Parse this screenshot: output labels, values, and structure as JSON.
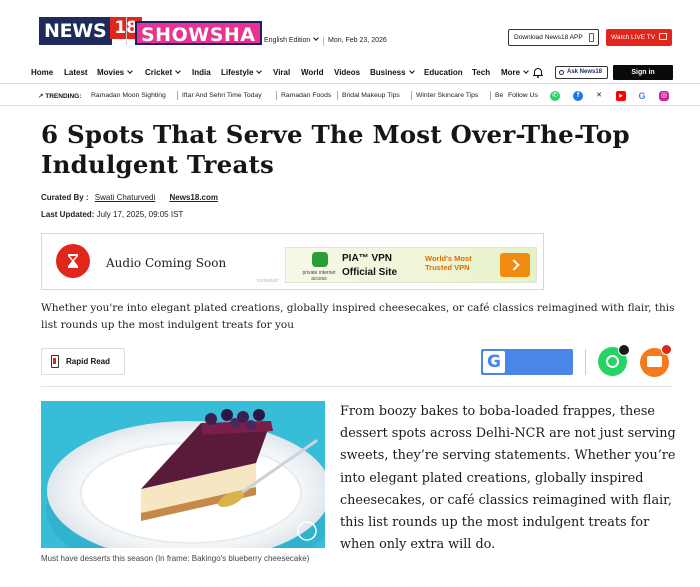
{
  "header": {
    "logo_news": "NEWS",
    "logo_num": "18",
    "logo_showsha": "SHOWSHA",
    "edition": "English Edition",
    "date": "Mon, Feb 23, 2026",
    "download_label": "Download News18 APP",
    "live_label": "Watch LIVE TV"
  },
  "nav": {
    "items": [
      {
        "label": "Home"
      },
      {
        "label": "Latest"
      },
      {
        "label": "Movies"
      },
      {
        "label": "Cricket"
      },
      {
        "label": "India"
      },
      {
        "label": "Lifestyle"
      },
      {
        "label": "Viral"
      },
      {
        "label": "World"
      },
      {
        "label": "Videos"
      },
      {
        "label": "Business"
      },
      {
        "label": "Education"
      },
      {
        "label": "Tech"
      },
      {
        "label": "More"
      }
    ],
    "ask_label": "Ask News18",
    "signin_label": "Sign in"
  },
  "trending": {
    "label": "TRENDING:",
    "items": [
      "Ramadan Moon Sighting",
      "Iftar And Sehri Time Today",
      "Ramadan Foods",
      "Bridal Makeup Tips",
      "Winter Skincare Tips",
      "Be"
    ],
    "follow_label": "Follow Us",
    "social": [
      "whatsapp-icon",
      "facebook-icon",
      "x-icon",
      "youtube-icon",
      "google-icon",
      "instagram-icon"
    ]
  },
  "article": {
    "headline": "6 Spots That Serve The Most Over-The-Top Indulgent Treats",
    "curated_label": "Curated By :",
    "author": "Swati Chaturvedi",
    "source": "News18.com",
    "updated_label": "Last Updated:",
    "updated_value": "July 17, 2025, 09:05 IST",
    "summary": "Whether you're into elegant plated creations, globally inspired cheesecakes, or café classics reimagined with flair, this list rounds up the most indulgent treats for you",
    "rapid_read": "Rapid Read",
    "caption": "Must have desserts this season (In frame: Bakingo's blueberry cheesecake)",
    "body": "From boozy bakes to boba-loaded frappes, these dessert spots across Delhi-NCR are not just serving sweets, they’re serving statements. Whether you’re into elegant plated creations, globally inspired cheesecakes, or café classics reimagined with flair, this list rounds up the most indulgent treats for when only extra will do."
  },
  "audio": {
    "label": "Audio Coming Soon",
    "powered": "Instaread"
  },
  "ad": {
    "brand": "private internet access",
    "line1": "PIA™ VPN",
    "line2": "Official Site",
    "tagline": "World's Most Trusted VPN"
  },
  "colors": {
    "brand_red": "#e1261c",
    "brand_navy": "#1e2a5a",
    "showsha_pink": "#e8338f",
    "whatsapp": "#25d366",
    "comment_orange": "#f47a20"
  }
}
